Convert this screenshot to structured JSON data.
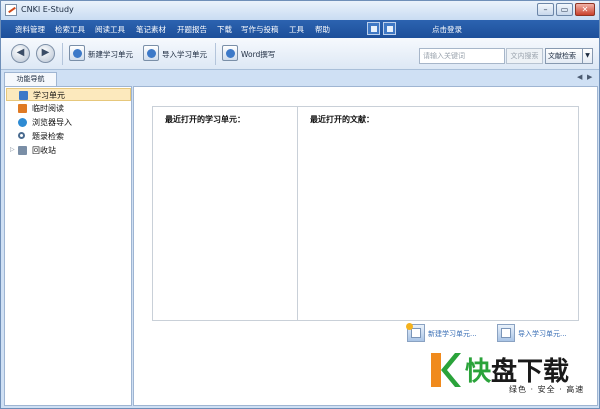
{
  "window": {
    "title": "CNKI E-Study",
    "controls": {
      "minimize": "–",
      "restore": "▭",
      "close": "✕"
    }
  },
  "menubar": {
    "items": [
      "资料管理",
      "检索工具",
      "阅读工具",
      "笔记素材",
      "开题报告",
      "下载",
      "写作与投稿",
      "工具",
      "帮助"
    ],
    "login": "点击登录",
    "icons": [
      "layout-icon",
      "book-icon"
    ]
  },
  "toolbar": {
    "back": "◀",
    "forward": "▶",
    "new_unit": "新建学习单元",
    "import_unit": "导入学习单元",
    "word_write": "Word撰写",
    "search_placeholder": "请输入关键词",
    "search_button": "文内搜索",
    "scope_select": "文献检索",
    "scope_arrow": "▼"
  },
  "tabs": {
    "nav_tab": "功能导航",
    "left": "◀",
    "right": "▶"
  },
  "tree": {
    "items": [
      {
        "label": "学习单元",
        "icon": "study-unit-icon",
        "color": "#3c79c8",
        "selected": true
      },
      {
        "label": "临时阅读",
        "icon": "temp-reading-icon",
        "color": "#e07a23",
        "selected": false
      },
      {
        "label": "浏览器导入",
        "icon": "browser-import-icon",
        "color": "#2e8bd3",
        "selected": false
      },
      {
        "label": "题录检索",
        "icon": "search-icon",
        "color": "#4a6b8f",
        "selected": false
      },
      {
        "label": "回收站",
        "icon": "recycle-bin-icon",
        "color": "#7a8ea6",
        "selected": false
      }
    ],
    "expander": "▷"
  },
  "main": {
    "recent_units": "最近打开的学习单元：",
    "recent_docs": "最近打开的文献：",
    "new_unit_link": "新建学习单元...",
    "import_unit_link": "导入学习单元..."
  },
  "watermark": {
    "mark": "K",
    "main_1": "快",
    "main_2": "盘下载",
    "sub": "绿色 · 安全 · 高速"
  },
  "colors": {
    "menubar": "#1d4f9a",
    "selection": "#fce9bd",
    "link": "#3a6fb6",
    "watermark_green": "#2aa33a",
    "watermark_orange": "#f08a1c"
  }
}
